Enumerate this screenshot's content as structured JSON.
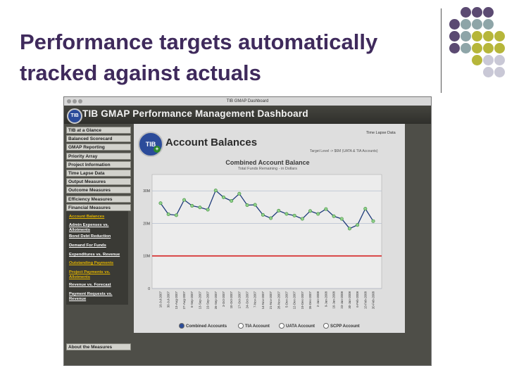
{
  "slide": {
    "title_line1": "Performance targets automatically",
    "title_line2": "tracked against actuals"
  },
  "colors": {
    "purple": "#5b4a72",
    "teal": "#8ea5a8",
    "olive": "#b6b63a",
    "lavender": "#c9c8d6"
  },
  "window": {
    "title": "TIB GMAP Dashboard"
  },
  "banner": {
    "logo_text": "TIB",
    "title": "TIB GMAP Performance Management Dashboard"
  },
  "sidebar": {
    "items": [
      "TIB at a Glance",
      "Balanced Scorecard",
      "GMAP Reporting",
      "Priority Array",
      "Project Information",
      "Time Lapse Data",
      "Output Measures",
      "Outcome Measures",
      "Efficiency Measures",
      "Financial Measures"
    ],
    "subitems": [
      {
        "label": "Account Balances",
        "highlight": true
      },
      {
        "label": "Admin Expenses vs. Allotments",
        "highlight": false
      },
      {
        "label": "Bond Debt Reduction",
        "highlight": false
      },
      {
        "label": "Demand For Funds",
        "highlight": false
      },
      {
        "label": "Expenditures vs. Revenue",
        "highlight": false
      },
      {
        "label": "Outstanding Payments",
        "highlight": true
      },
      {
        "label": "Project Payments vs. Allotments",
        "highlight": true
      },
      {
        "label": "Revenue vs. Forecast",
        "highlight": false
      },
      {
        "label": "Payment Requests vs. Revenue",
        "highlight": false
      }
    ],
    "about": "About the Measures"
  },
  "page": {
    "logo_text": "TIB",
    "title": "Account Balances",
    "time_lapse": "Time Lapse Data",
    "target_label": "Target Level -> $6M (UATA & TIA Accounts)"
  },
  "legend": [
    "Combined Accounts",
    "TIA Account",
    "UATA Account",
    "SCPP Account"
  ],
  "chart_data": {
    "type": "line",
    "title": "Combined Account Balance",
    "subtitle": "Total Funds Remaining - in Dollars",
    "yticks": [
      "0",
      "10M",
      "20M",
      "30M"
    ],
    "ylim": [
      0,
      35
    ],
    "target": 10,
    "target_color": "#d42020",
    "series_color": "#1e3a7a",
    "x": [
      "16-Jul-2007",
      "30-Jul-2007",
      "13-Aug-2007",
      "27-Aug-2007",
      "6-Sep-2007",
      "13-Sep-2007",
      "19-Sep-2007",
      "26-Sep-2007",
      "3-Oct-2007",
      "10-Oct-2007",
      "17-Oct-2007",
      "24-Oct-2007",
      "7-Nov-2007",
      "14-Nov-2007",
      "21-Nov-2007",
      "28-Nov-2007",
      "5-Dec-2007",
      "12-Dec-2007",
      "19-Dec-2007",
      "26-Dec-2007",
      "2-Jan-2008",
      "9-Jan-2008",
      "16-Jan-2008",
      "23-Jan-2008",
      "30-Jan-2008",
      "6-Feb-2008",
      "13-Feb-2008",
      "20-Feb-2008"
    ],
    "values": [
      26.2,
      22.8,
      22.5,
      27.2,
      25.4,
      24.9,
      24.2,
      30.1,
      28.0,
      26.9,
      29.1,
      25.6,
      25.7,
      22.6,
      21.6,
      23.9,
      22.9,
      22.4,
      21.4,
      23.8,
      22.9,
      24.4,
      22.2,
      21.4,
      18.4,
      19.5,
      24.5,
      20.7
    ]
  }
}
